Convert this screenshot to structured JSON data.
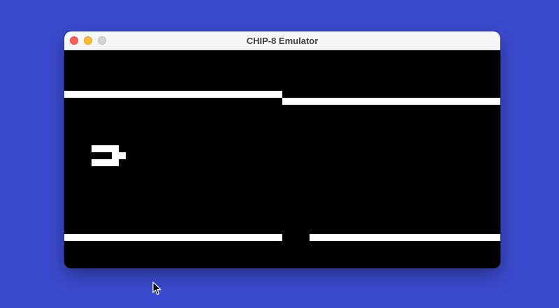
{
  "window": {
    "title": "CHIP-8 Emulator"
  },
  "screen": {
    "background": "#000000",
    "foreground": "#ffffff",
    "sprites": [
      "top-wall-left",
      "top-wall-right",
      "player-ship",
      "bottom-wall-left",
      "bottom-wall-right"
    ]
  },
  "colors": {
    "desktop": "#3b4bcf",
    "close": "#ff5f57",
    "minimize": "#febc2e",
    "zoom": "#d3d3d3"
  },
  "icons": {
    "close": "close-icon",
    "minimize": "minimize-icon",
    "zoom": "zoom-icon",
    "cursor": "mouse-pointer-icon"
  }
}
